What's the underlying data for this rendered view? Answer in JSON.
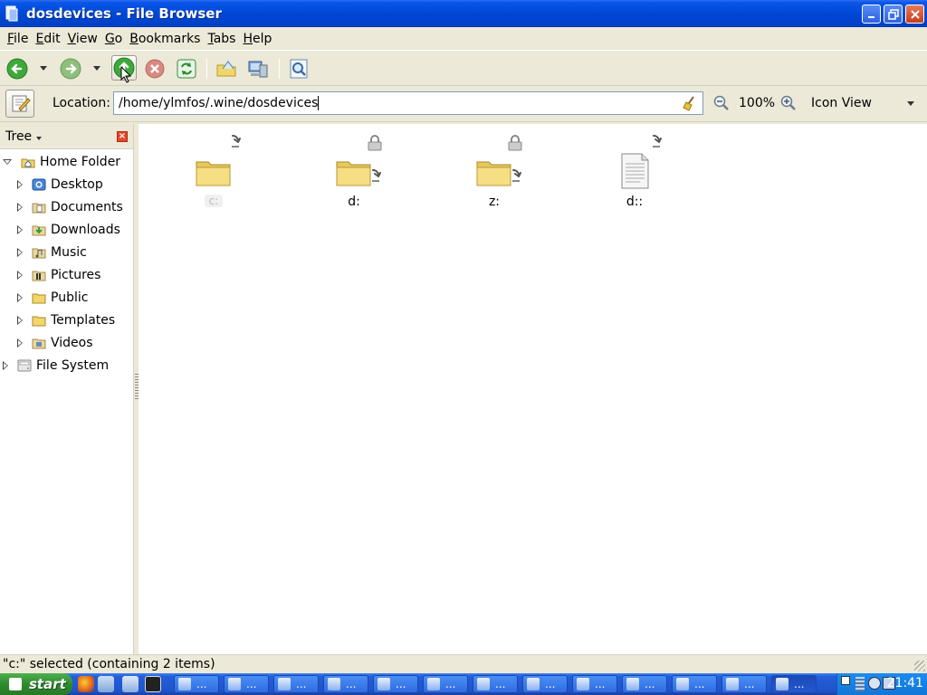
{
  "window": {
    "title": "dosdevices - File Browser"
  },
  "menubar": {
    "items": [
      {
        "label": "File",
        "key": "F",
        "rest": "ile"
      },
      {
        "label": "Edit",
        "key": "E",
        "rest": "dit"
      },
      {
        "label": "View",
        "key": "V",
        "rest": "iew"
      },
      {
        "label": "Go",
        "key": "G",
        "rest": "o"
      },
      {
        "label": "Bookmarks",
        "key": "B",
        "rest": "ookmarks"
      },
      {
        "label": "Tabs",
        "key": "T",
        "rest": "abs"
      },
      {
        "label": "Help",
        "key": "H",
        "rest": "elp"
      }
    ]
  },
  "toolbar": {
    "buttons": [
      "back-icon",
      "forward-icon",
      "up-icon",
      "stop-icon",
      "reload-icon",
      "home-icon",
      "computer-icon",
      "search-icon"
    ]
  },
  "location": {
    "label": "Location:",
    "path": "/home/ylmfos/.wine/dosdevices",
    "zoom": "100%",
    "view_mode": "Icon View"
  },
  "sidepane": {
    "title": "Tree",
    "items": [
      {
        "label": "Home Folder",
        "icon": "home-folder-icon",
        "expanded": true,
        "level": 0
      },
      {
        "label": "Desktop",
        "icon": "desktop-icon",
        "expanded": false,
        "level": 1
      },
      {
        "label": "Documents",
        "icon": "documents-icon",
        "expanded": false,
        "level": 1
      },
      {
        "label": "Downloads",
        "icon": "downloads-icon",
        "expanded": false,
        "level": 1
      },
      {
        "label": "Music",
        "icon": "music-icon",
        "expanded": false,
        "level": 1
      },
      {
        "label": "Pictures",
        "icon": "pictures-icon",
        "expanded": false,
        "level": 1
      },
      {
        "label": "Public",
        "icon": "public-folder-icon",
        "expanded": false,
        "level": 1
      },
      {
        "label": "Templates",
        "icon": "templates-folder-icon",
        "expanded": false,
        "level": 1
      },
      {
        "label": "Videos",
        "icon": "videos-icon",
        "expanded": false,
        "level": 1
      },
      {
        "label": "File System",
        "icon": "filesystem-icon",
        "expanded": false,
        "level": 0
      }
    ]
  },
  "files": [
    {
      "name": "c:",
      "type": "folder",
      "symlink": true,
      "locked": false,
      "selected": true
    },
    {
      "name": "d:",
      "type": "folder",
      "symlink": true,
      "locked": true,
      "selected": false
    },
    {
      "name": "z:",
      "type": "folder",
      "symlink": true,
      "locked": true,
      "selected": false
    },
    {
      "name": "d::",
      "type": "file",
      "symlink": true,
      "locked": false,
      "selected": false
    }
  ],
  "statusbar": {
    "text": "\"c:\" selected (containing 2 items)"
  },
  "taskbar": {
    "start_label": "start",
    "task_label": "...",
    "clock": "21:41"
  },
  "colors": {
    "titlebar": "#0047d6",
    "folder": "#f2d66b",
    "taskbar": "#245edb",
    "start": "#2e8b2e"
  }
}
